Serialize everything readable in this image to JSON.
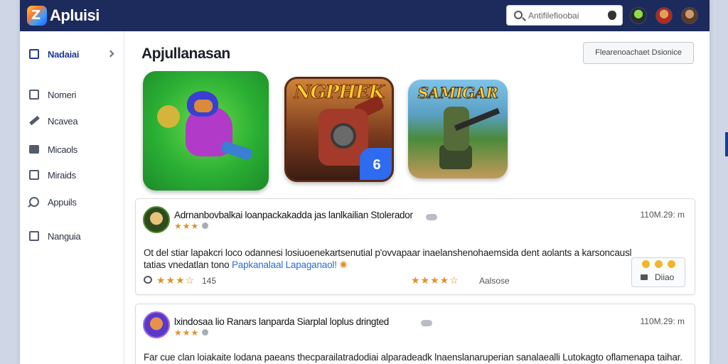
{
  "app": {
    "title": "Apluisi"
  },
  "header": {
    "search_placeholder": "Antifilefioobai",
    "avatars": [
      "avatar-1",
      "avatar-2",
      "avatar-3"
    ]
  },
  "sidebar": {
    "items": [
      {
        "label": "Nadaiai",
        "icon": "list-icon",
        "active": true
      },
      {
        "label": "Nomeri",
        "icon": "clipboard-icon"
      },
      {
        "label": "Ncavea",
        "icon": "pencil-icon"
      },
      {
        "label": "Micaols",
        "icon": "box-icon"
      },
      {
        "label": "Miraids",
        "icon": "image-icon"
      },
      {
        "label": "Appuils",
        "icon": "pin-icon"
      },
      {
        "label": "Nanguia",
        "icon": "gallery-icon"
      }
    ]
  },
  "main": {
    "title": "Apjullanasan",
    "filter_button": "Flearenoachaet Dsionice",
    "apps": [
      {
        "title": ""
      },
      {
        "title": "NGPHEK",
        "badge": "6"
      },
      {
        "title": "SAMIGAR"
      }
    ]
  },
  "reviews": [
    {
      "title": "Adrnanbovbalkai loanpackakadda jas lanlkailian Stolerador",
      "rating_display": "★★★",
      "time": "110M.29: m",
      "body": "Ot del stiar lapakcri loco odannesi losiuoenekartsenutial p'ovvapaar inaelanshenohaemsida dent aolants a karsoncausl tatias vnedatlan tono",
      "link": "Papkanalaal Lapaganaol!",
      "footer": {
        "stars_left": "★★★☆",
        "count": "145",
        "stars_right": "★★★★☆",
        "label": "Aalsose"
      },
      "reply_label": "Diiao"
    },
    {
      "title": "lxindosaa lio Ranars lanparda Siarplal loplus dringted",
      "rating_display": "★★★",
      "time": "110M.29: m",
      "body": "Far cue clan loiakaite lodana paeans thecparailatradodiai alparadeadk lnaenslanaruperian sanalaealli Lutokagto oflamenapa taihar."
    }
  ],
  "colors": {
    "header": "#1c2a5c",
    "accent": "#1c3a9a",
    "star": "#e2902a",
    "link": "#2a6fd8"
  }
}
